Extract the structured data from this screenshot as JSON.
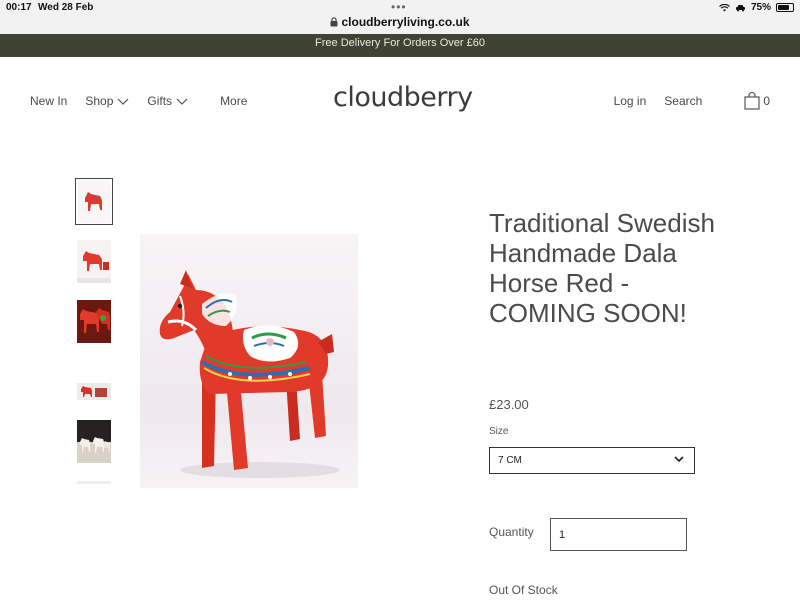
{
  "status_bar": {
    "time": "00:17",
    "date": "Wed 28 Feb",
    "dots": "•••",
    "battery": "75%",
    "battery_level": 0.75,
    "url": "cloudberryliving.co.uk"
  },
  "promo": {
    "text": "Free Delivery For Orders Over £60"
  },
  "nav": {
    "left": [
      "New In",
      "Shop",
      "Gifts",
      "More"
    ],
    "logo": "cloudberry",
    "login": "Log in",
    "search": "Search",
    "cart_count": "0"
  },
  "product": {
    "title": "Traditional Swedish Handmade Dala Horse Red - COMING SOON!",
    "price": "£23.00",
    "size_label": "Size",
    "size_value": "7 CM",
    "quantity_label": "Quantity",
    "quantity_value": "1",
    "stock": "Out Of Stock"
  },
  "colors": {
    "banner_bg": "#3f4332",
    "horse_red": "#e23a2a"
  }
}
